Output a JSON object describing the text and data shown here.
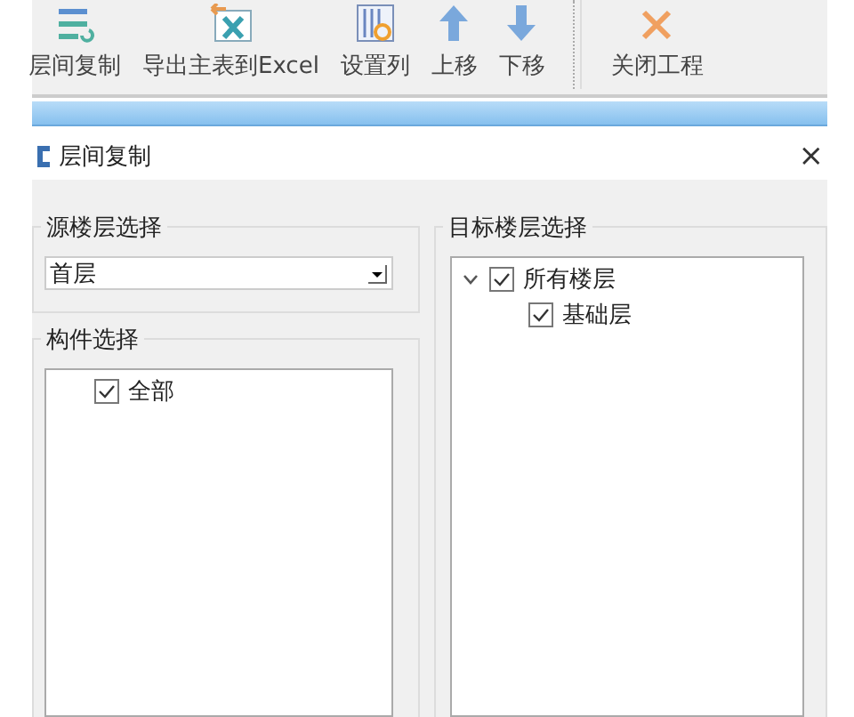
{
  "toolbar": {
    "buttons": [
      {
        "kind": "copy",
        "label": "层间复制"
      },
      {
        "kind": "excel",
        "label": "导出主表到Excel"
      },
      {
        "kind": "columns",
        "label": "设置列"
      },
      {
        "kind": "up",
        "label": "上移"
      },
      {
        "kind": "down",
        "label": "下移"
      },
      {
        "kind": "close",
        "label": "关闭工程",
        "separator_before": true
      }
    ]
  },
  "dialog": {
    "title": "层间复制",
    "close": "×",
    "source_floor": {
      "title": "源楼层选择",
      "value": "首层"
    },
    "components": {
      "title": "构件选择",
      "items": [
        {
          "label": "全部",
          "checked": true
        }
      ]
    },
    "target_floor": {
      "title": "目标楼层选择",
      "items": [
        {
          "label": "所有楼层",
          "checked": true,
          "expanded": true,
          "children": [
            {
              "label": "基础层",
              "checked": true
            }
          ]
        }
      ]
    }
  }
}
